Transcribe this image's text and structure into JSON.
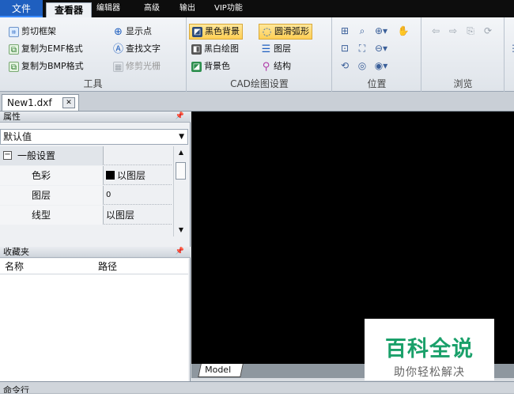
{
  "tabs": {
    "file": "文件",
    "viewer": "查看器",
    "editor": "编辑器",
    "advanced": "高级",
    "output": "输出",
    "vip": "VIP功能"
  },
  "ribbon": {
    "tools": {
      "label": "工具",
      "crop_frame": "剪切框架",
      "copy_emf": "复制为EMF格式",
      "copy_bmp": "复制为BMP格式",
      "show_points": "显示点",
      "find_text": "查找文字",
      "trim_raster": "修剪光栅"
    },
    "cad_settings": {
      "label": "CAD绘图设置",
      "black_bg": "黑色背景",
      "bw_drawing": "黑白绘图",
      "bg_color": "背景色",
      "smooth_arc": "圆滑弧形",
      "layers": "图层",
      "structure": "结构"
    },
    "position": {
      "label": "位置"
    },
    "browse": {
      "label": "浏览"
    }
  },
  "document": {
    "tab_name": "New1.dxf"
  },
  "properties": {
    "header": "属性",
    "selector": "默认值",
    "category": "一般设置",
    "rows": [
      {
        "key": "色彩",
        "value": "以图层"
      },
      {
        "key": "图层",
        "value": "0"
      },
      {
        "key": "线型",
        "value": "以图层"
      }
    ]
  },
  "favorites": {
    "header": "收藏夹",
    "col_name": "名称",
    "col_path": "路径"
  },
  "canvas": {
    "model_tab": "Model"
  },
  "watermark": {
    "title": "百科全说",
    "subtitle": "助你轻松解决"
  },
  "command": {
    "label": "命令行"
  },
  "colors": {
    "canvas_bg": "#000000",
    "file_tab": "#1f5fbf",
    "active_button": "#ffcf55",
    "watermark_green": "#1aa06a"
  }
}
